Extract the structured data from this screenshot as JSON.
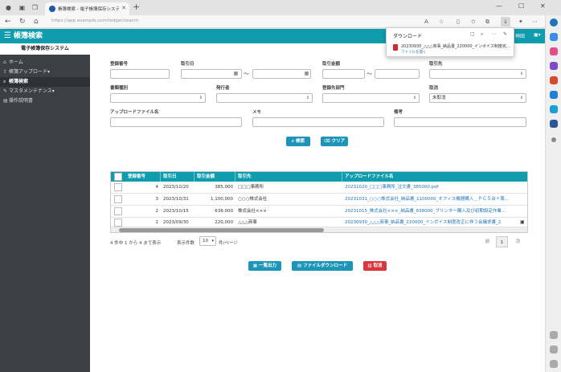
{
  "browser": {
    "tab_title": "帳簿検索 - 電子帳簿保存システム",
    "url": "https://app.example.com/ledger/search"
  },
  "download_popup": {
    "title": "ダウンロード",
    "filename": "20230930_△△△商事_納品書_220000_インボイス制度完...",
    "open_label": "ファイルを開く"
  },
  "header": {
    "title": "帳簿検索",
    "user": "神田"
  },
  "sidebar": {
    "system_name": "電子帳簿保存システム",
    "items": [
      {
        "icon": "home-icon",
        "glyph": "⌂",
        "label": "ホーム"
      },
      {
        "icon": "upload-icon",
        "glyph": "⇪",
        "label": "帳簿アップロード▾"
      },
      {
        "icon": "search-icon",
        "glyph": "⌕",
        "label": "帳簿検索"
      },
      {
        "icon": "wrench-icon",
        "glyph": "✎",
        "label": "マスタメンテナンス▾"
      },
      {
        "icon": "book-icon",
        "glyph": "▤",
        "label": "操作説明書"
      }
    ]
  },
  "form": {
    "reg_no_label": "登録番号",
    "txn_date_label": "取引日",
    "txn_amount_label": "取引金額",
    "partner_label": "取引先",
    "doc_type_label": "書類種別",
    "issuer_label": "発行者",
    "reg_dept_label": "登録先部門",
    "cancel_label": "取消",
    "cancel_value": "未取消",
    "upload_file_label": "アップロードファイル名",
    "memo_label": "メモ",
    "remarks_label": "備考",
    "tilde": "〜"
  },
  "buttons": {
    "search": "検索",
    "clear": "クリア",
    "list_output": "一覧出力",
    "file_download": "ファイルダウンロード",
    "cancel": "取消"
  },
  "table": {
    "columns": [
      "登録番号",
      "取引日",
      "取引金額",
      "取引先",
      "アップロードファイル名"
    ],
    "rows": [
      {
        "no": "4",
        "date": "2023/10/20",
        "amount": "385,000",
        "partner": "□□□事務所",
        "file": "20231020_□□□事務所_注文書_385000.pdf"
      },
      {
        "no": "3",
        "date": "2023/10/31",
        "amount": "1,100,000",
        "partner": "○○○株式会社",
        "file": "20231031_○○○株式会社_納品書_1100000_オフィス機器購入＿ＰＣ５台＋周..."
      },
      {
        "no": "2",
        "date": "2023/10/15",
        "amount": "638,000",
        "partner": "株式会社×××",
        "file": "20231015_株式会社×××_納品書_638000_プリンター購入及び初期設定作業..."
      },
      {
        "no": "1",
        "date": "2023/09/30",
        "amount": "220,000",
        "partner": "△△△商事",
        "file": "20230930_△△△商事_納品書_220000_インボイス制度改正に伴う会議求書_2"
      }
    ]
  },
  "pagination": {
    "summary": "4 件中 1 から 4 まで表示",
    "per_page_prefix": "表示件数",
    "per_page_value": "10",
    "per_page_suffix": "件/ページ",
    "prev": "前",
    "current": "1",
    "next": "次"
  }
}
